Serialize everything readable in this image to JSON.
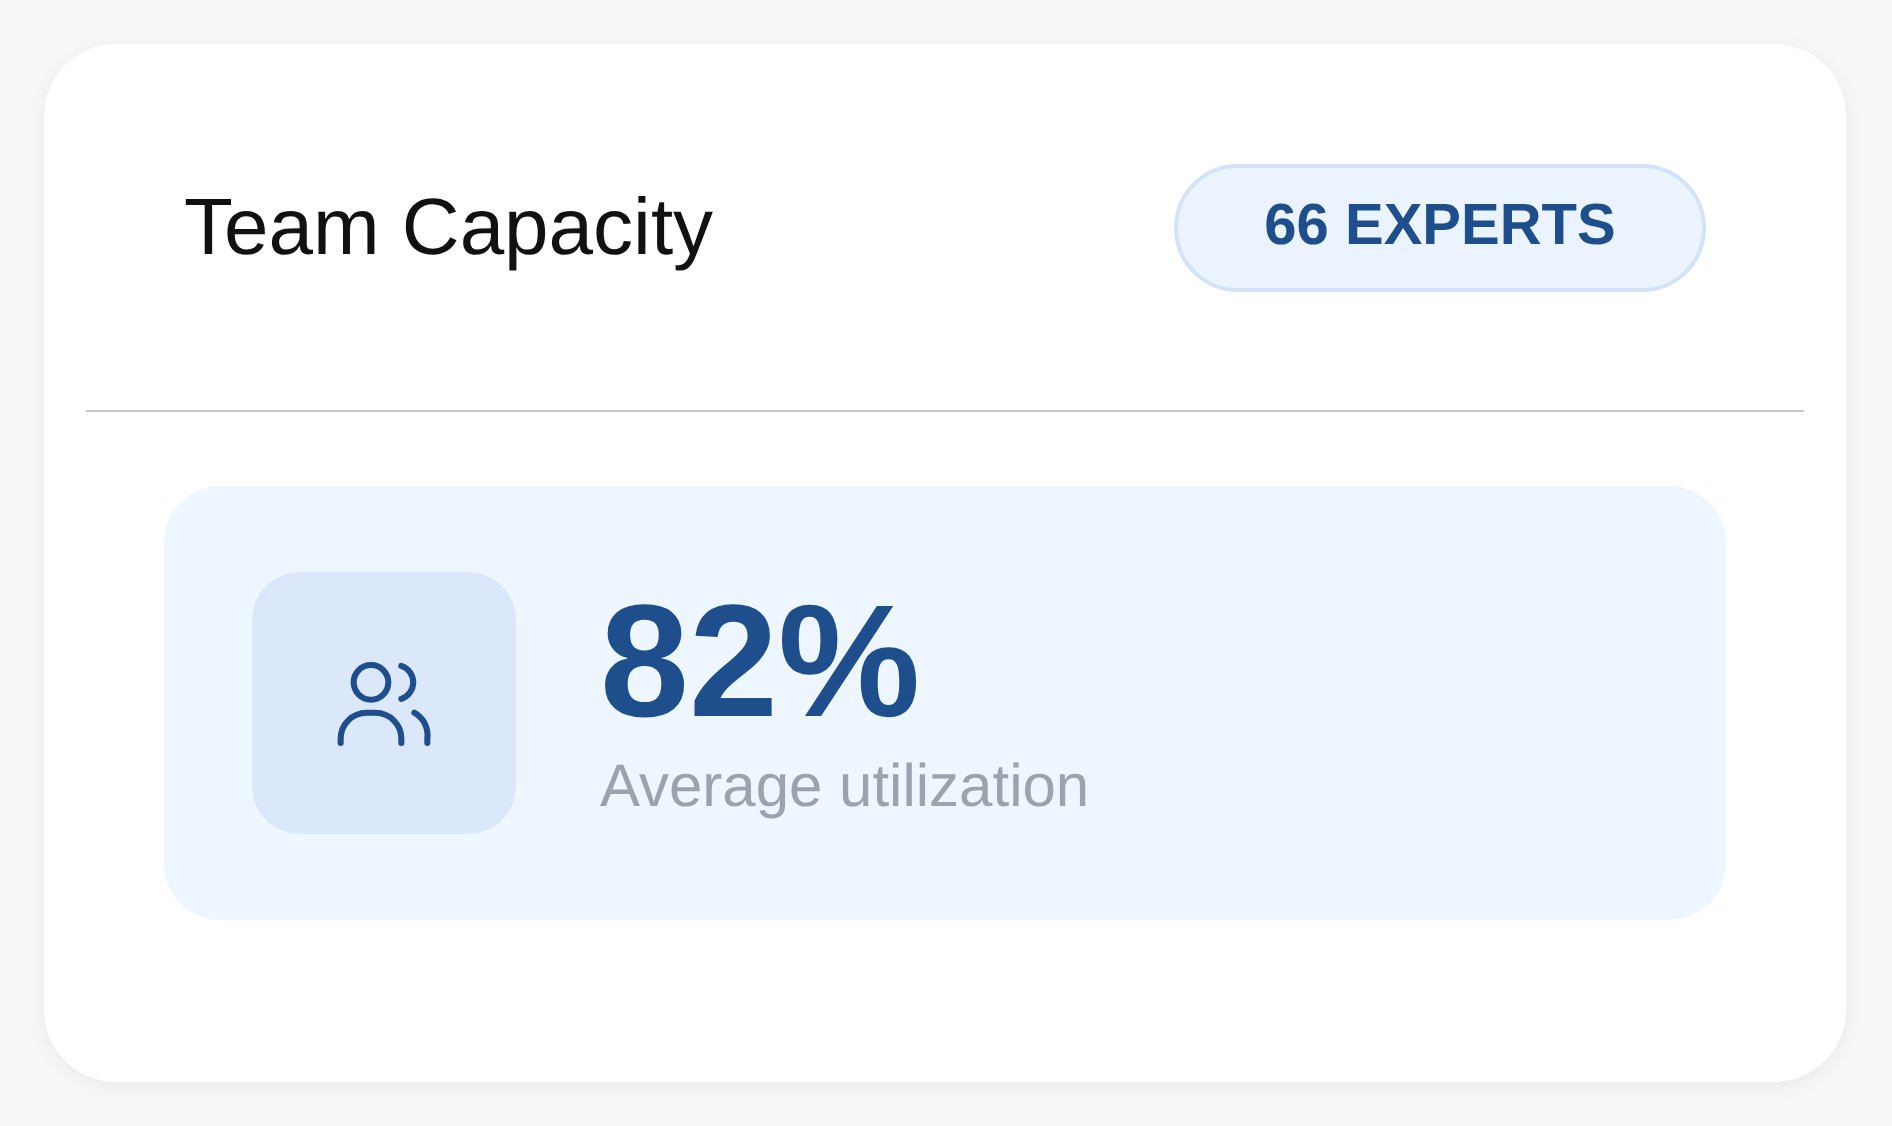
{
  "card": {
    "title": "Team Capacity",
    "badge": "66 EXPERTS"
  },
  "stat": {
    "value": "82%",
    "label": "Average utilization"
  }
}
